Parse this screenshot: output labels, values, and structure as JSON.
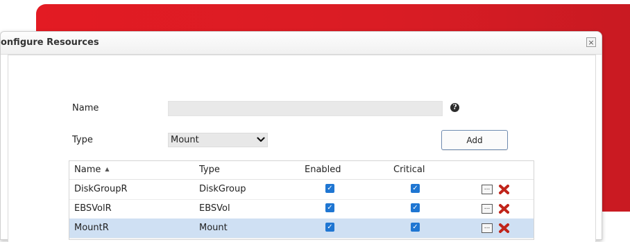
{
  "dialog": {
    "title": "onfigure Resources",
    "close_glyph": "×"
  },
  "form": {
    "name_label": "Name",
    "name_value": "",
    "help_glyph": "?",
    "type_label": "Type",
    "type_selected": "Mount",
    "add_label": "Add"
  },
  "table": {
    "columns": [
      "Name",
      "Type",
      "Enabled",
      "Critical"
    ],
    "sort_glyph": "▲",
    "rows": [
      {
        "name": "DiskGroupR",
        "type": "DiskGroup",
        "enabled": true,
        "critical": true,
        "selected": false
      },
      {
        "name": "EBSVolR",
        "type": "EBSVol",
        "enabled": true,
        "critical": true,
        "selected": false
      },
      {
        "name": "MountR",
        "type": "Mount",
        "enabled": true,
        "critical": true,
        "selected": true
      }
    ],
    "edit_glyph": "...",
    "check_glyph": "✓"
  },
  "colors": {
    "accent_red": "#d91c24",
    "delete_red": "#c0241a",
    "checkbox_blue": "#1f76d2",
    "selected_row": "#cfe0f3"
  },
  "icons": [
    "help-icon",
    "chevron-down-icon",
    "sort-ascending-icon",
    "checkbox-checked-icon",
    "ellipsis-button-icon",
    "delete-x-icon",
    "close-icon"
  ]
}
